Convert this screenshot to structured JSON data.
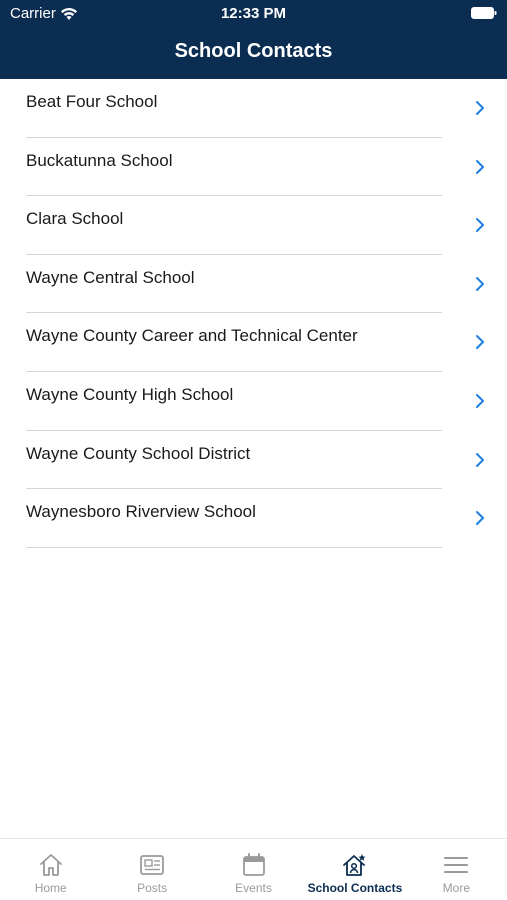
{
  "status_bar": {
    "carrier": "Carrier",
    "time": "12:33 PM"
  },
  "header": {
    "title": "School Contacts"
  },
  "schools": [
    {
      "name": "Beat Four School"
    },
    {
      "name": "Buckatunna School"
    },
    {
      "name": "Clara School"
    },
    {
      "name": "Wayne Central School"
    },
    {
      "name": "Wayne County Career and Technical Center"
    },
    {
      "name": "Wayne County High School"
    },
    {
      "name": "Wayne County School District"
    },
    {
      "name": "Waynesboro Riverview School"
    }
  ],
  "tabbar": {
    "tabs": [
      {
        "label": "Home",
        "icon": "home-icon"
      },
      {
        "label": "Posts",
        "icon": "posts-icon"
      },
      {
        "label": "Events",
        "icon": "calendar-icon"
      },
      {
        "label": "School Contacts",
        "icon": "school-contacts-icon",
        "active": true
      },
      {
        "label": "More",
        "icon": "menu-icon"
      }
    ]
  },
  "colors": {
    "header_bg": "#0b2d52",
    "chevron": "#1f7fe0",
    "active_tab": "#0b2d52",
    "inactive_tab": "#9a9a9a"
  }
}
